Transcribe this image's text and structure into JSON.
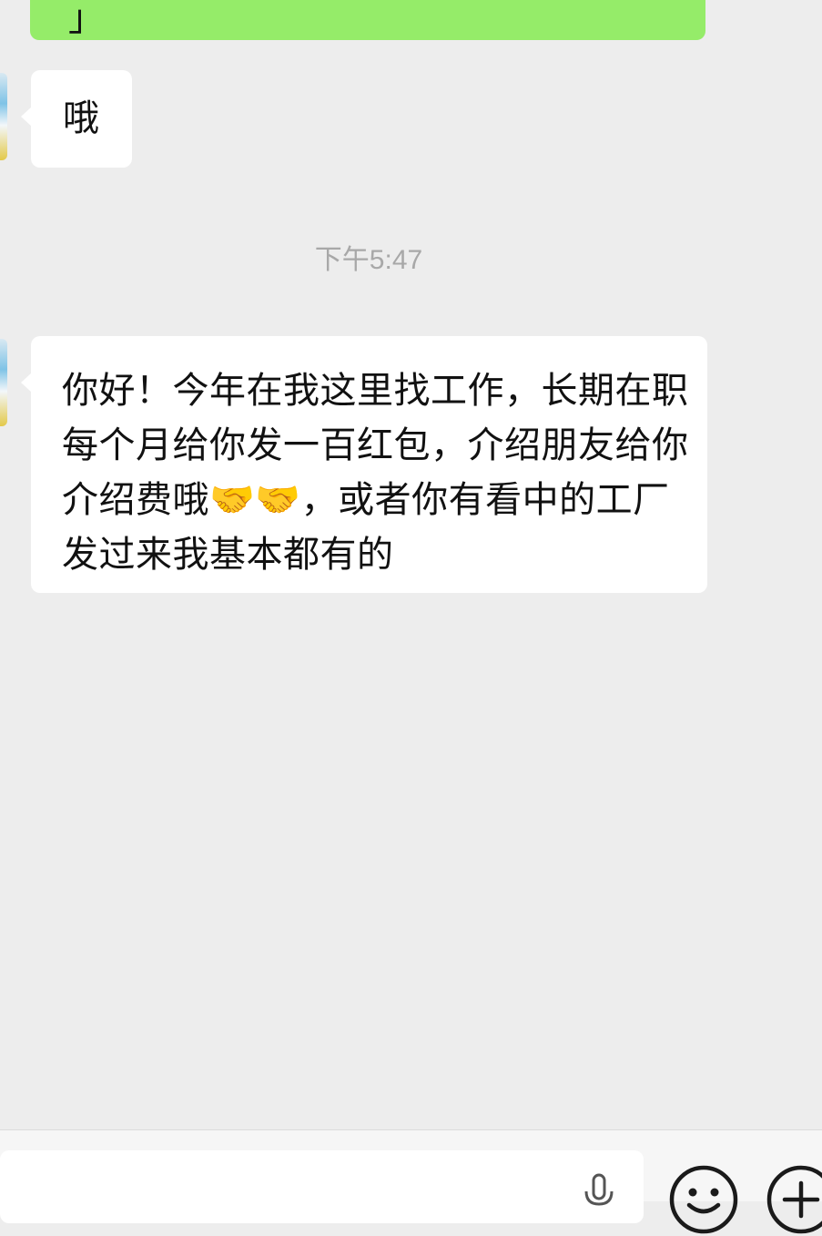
{
  "chat": {
    "sent_message_partial": "」",
    "messages": [
      {
        "sender": "other",
        "text": "哦"
      },
      {
        "sender": "other",
        "text": "你好！今年在我这里找工作，长期在职每个月给你发一百红包，介绍朋友给你介绍费哦🤝🤝，或者你有看中的工厂发过来我基本都有的"
      }
    ],
    "timestamp": "下午5:47"
  },
  "input_bar": {
    "message_input_value": "",
    "icons": [
      "voice-icon",
      "emoji-icon",
      "plus-icon"
    ]
  },
  "colors": {
    "background": "#ededed",
    "sent_bubble": "#95ec69",
    "received_bubble": "#ffffff",
    "timestamp_text": "#a8a8a8"
  }
}
